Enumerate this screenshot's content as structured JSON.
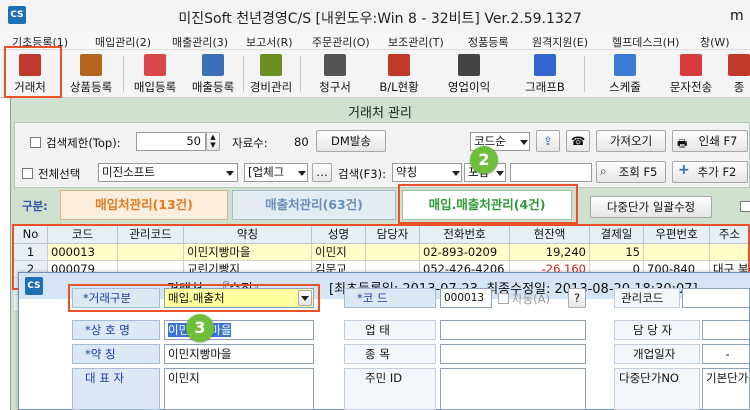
{
  "window": {
    "app_icon": "CS",
    "title": "미진Soft 천년경영C/S [내윈도우:Win 8 - 32비트] Ver.2.59.1327",
    "title_tail": "m"
  },
  "menu": [
    "기초등록(1)",
    "매입관리(2)",
    "매출관리(3)",
    "보고서(R)",
    "주문관리(O)",
    "보조관리(T)",
    "정품등록",
    "원격지원(E)",
    "헬프데스크(H)",
    "창(W)"
  ],
  "toolbar": [
    {
      "label": "거래처",
      "icon": "client-book-icon",
      "color": "#c0392b"
    },
    {
      "label": "상품등록",
      "icon": "product-box-icon",
      "color": "#b5651d"
    },
    {
      "label": "매입등록",
      "icon": "purchase-doc-icon",
      "color": "#d94848"
    },
    {
      "label": "매출등록",
      "icon": "sales-doc-icon",
      "color": "#3b6fb6"
    },
    {
      "label": "경비관리",
      "icon": "expense-icon",
      "color": "#6b8e23"
    },
    {
      "label": "청구서",
      "icon": "invoice-icon",
      "color": "#555555"
    },
    {
      "label": "B/L현황",
      "icon": "bl-status-icon",
      "color": "#c0392b"
    },
    {
      "label": "영업이익",
      "icon": "profit-icon",
      "color": "#444444"
    },
    {
      "label": "그래프B",
      "icon": "bar-chart-icon",
      "color": "#3366cc"
    },
    {
      "label": "스케줄",
      "icon": "calendar-icon",
      "color": "#3a7bd5"
    },
    {
      "label": "문자전송",
      "icon": "sms-icon",
      "color": "#d83b3b"
    },
    {
      "label": "종",
      "icon": "more-icon",
      "color": "#c0392b"
    }
  ],
  "main": {
    "title": "거래처 관리",
    "search_limit_label": "검색제한(Top):",
    "search_limit_value": "50",
    "count_label": "자료수:",
    "count_value": "80",
    "dm_button": "DM발송",
    "sort_value": "코드순",
    "fetch_button": "가져오기",
    "print_button": "인쇄 F7",
    "select_all_label": "전체선택",
    "company_value": "미진소프트",
    "industry_value": "[업체그",
    "search_label": "검색(F3):",
    "search_field_value": "약칭",
    "search_op_value": "포함",
    "query_button": "조회 F5",
    "add_button": "추가 F2",
    "category_label": "구분:",
    "tabs": [
      {
        "label": "매입처관리(13건)",
        "color": "#e07b20"
      },
      {
        "label": "매출처관리(63건)",
        "color": "#6a8fb5"
      },
      {
        "label": "매입.매출처관리(4건)",
        "color": "#2e9b3a"
      }
    ],
    "multi_price_button": "다중단가 일괄수정"
  },
  "grid": {
    "columns": [
      "No",
      "코드",
      "관리코드",
      "약칭",
      "성명",
      "담당자",
      "전화번호",
      "현잔액",
      "결제일",
      "우편번호",
      "주소"
    ],
    "rows": [
      [
        "1",
        "000013",
        "",
        "이민지빵마을",
        "이민지",
        "",
        "02-893-0209",
        "19,240",
        "15",
        "",
        ""
      ],
      [
        "2",
        "000079",
        "",
        "교린기빵지",
        "김문교",
        "",
        "052-426-4206",
        "-26,160",
        "0",
        "700-840",
        "대구 북"
      ],
      [
        "3",
        "",
        "",
        "",
        "",
        "",
        "",
        "",
        "",
        "",
        ""
      ],
      [
        "4",
        "",
        "",
        "",
        "",
        "",
        "",
        "",
        "",
        "",
        ""
      ]
    ]
  },
  "dialog": {
    "icon": "CS",
    "title": "거래처 - 『수정』",
    "info": "[최초등록일: 2013-07-23, 최종수정일: 2013-08-20 18:30:07]",
    "close": "✕",
    "type_label": "*거래구분",
    "type_value": "매입.매출처",
    "code_label": "*코    드",
    "code_value": "000013",
    "auto_label": "자동(A)",
    "help_button": "?",
    "mgmt_code_label": "관리코드",
    "company_label": "*상 호 명",
    "company_value": "이민지빵마을",
    "alias_label": "*약    칭",
    "alias_value": "이민지빵마을",
    "rep_label": "대 표 자",
    "rep_value": "이민지",
    "business_label": "업    태",
    "item_label": "종    목",
    "main_id_label": "주민 ID",
    "manager_label": "담 당 자",
    "open_date_label": "개업일자",
    "open_date_value": "-",
    "multi_price_label": "다중단가NO",
    "multi_price_value": "기본단가"
  },
  "callouts": [
    "1",
    "2",
    "3"
  ],
  "colors": {
    "callout_green": "#6fbe3b",
    "highlight_red": "#e8512a",
    "selected_row": "#fffdc8",
    "dialog_label_text": "#1a3f9e"
  }
}
